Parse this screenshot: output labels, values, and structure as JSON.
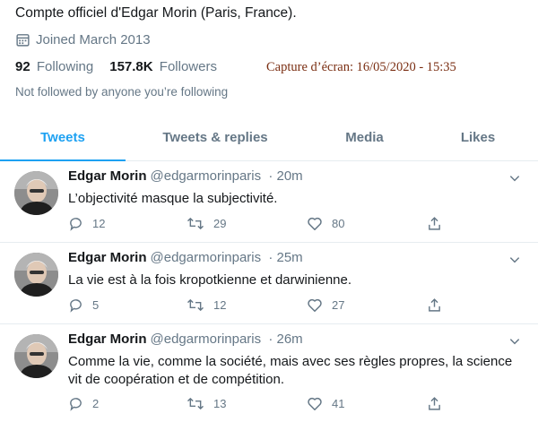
{
  "profile": {
    "bio": "Compte officiel d'Edgar Morin (Paris, France).",
    "joined": "Joined March 2013",
    "following_count": "92",
    "following_label": "Following",
    "followers_count": "157.8K",
    "followers_label": "Followers",
    "not_followed": "Not followed by anyone you’re following"
  },
  "capture_note": "Capture d’écran: 16/05/2020 - 15:35",
  "tabs": [
    {
      "label": "Tweets",
      "active": true
    },
    {
      "label": "Tweets & replies",
      "active": false
    },
    {
      "label": "Media",
      "active": false
    },
    {
      "label": "Likes",
      "active": false
    }
  ],
  "tweets": [
    {
      "name": "Edgar Morin",
      "handle": "@edgarmorinparis",
      "time": "· 20m",
      "text": "L’objectivité masque la subjectivité.",
      "replies": "12",
      "retweets": "29",
      "likes": "80"
    },
    {
      "name": "Edgar Morin",
      "handle": "@edgarmorinparis",
      "time": "· 25m",
      "text": "La vie est à la fois kropotkienne et darwinienne.",
      "replies": "5",
      "retweets": "12",
      "likes": "27"
    },
    {
      "name": "Edgar Morin",
      "handle": "@edgarmorinparis",
      "time": "· 26m",
      "text": "Comme la vie, comme la société, mais avec ses règles propres, la science vit de coopération et de compétition.",
      "replies": "2",
      "retweets": "13",
      "likes": "41"
    }
  ],
  "colors": {
    "accent": "#1da1f2",
    "secondary_text": "#657786",
    "capture_note": "#7a2e12"
  }
}
